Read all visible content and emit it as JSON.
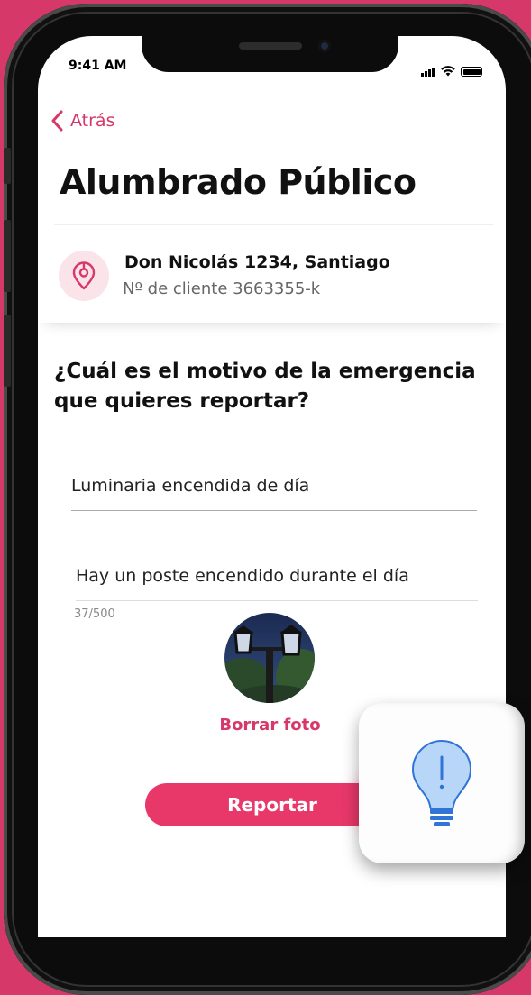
{
  "status_bar": {
    "time": "9:41 AM"
  },
  "nav": {
    "back_label": "Atrás"
  },
  "page": {
    "title": "Alumbrado Público"
  },
  "address": {
    "street": "Don Nicolás 1234, Santiago",
    "client": "Nº de cliente 3663355-k",
    "icon": "location-pin-icon"
  },
  "form": {
    "question": "¿Cuál es el motivo de la emergencia que quieres reportar?",
    "reason_value": "Luminaria encendida de día",
    "description_value": "Hay un poste encendido durante el día",
    "char_counter": "37/500",
    "delete_photo_label": "Borrar foto",
    "submit_label": "Reportar"
  },
  "colors": {
    "accent": "#d6386a",
    "button": "#e8386a",
    "pin_bg": "#fbe3ea"
  },
  "tip": {
    "icon": "lightbulb-exclamation-icon"
  }
}
